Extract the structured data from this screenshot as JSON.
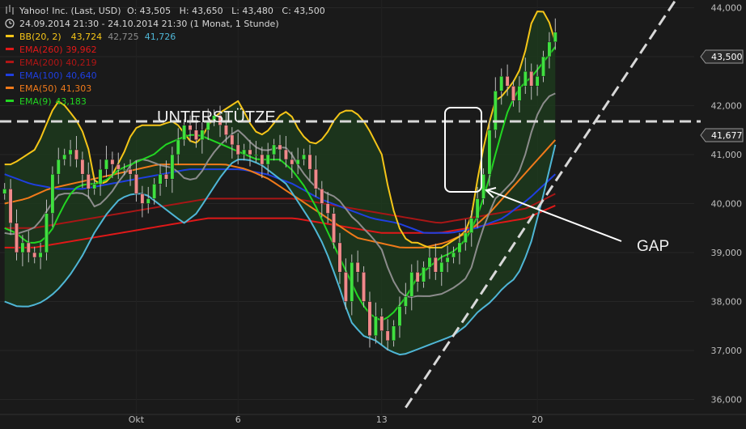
{
  "header": {
    "instrument": "Yahoo! Inc. (Last, USD)",
    "ohlc": "O: 43,505   H: 43,650   L: 43,480   C: 43,500",
    "period": "24.09.2014 21:30 - 24.10.2014 21:30 (1 Monat, 1 Stunde)"
  },
  "legend": [
    {
      "name": "BB(20, 2)",
      "values": [
        "43,724",
        "42,725",
        "41,726"
      ],
      "colors": [
        "#f5c518",
        "#8c8c8c",
        "#4fb6d6"
      ]
    },
    {
      "name": "EMA(260)",
      "values": [
        "39,962"
      ],
      "colors": [
        "#e01818"
      ]
    },
    {
      "name": "EMA(200)",
      "values": [
        "40,219"
      ],
      "colors": [
        "#b01515"
      ]
    },
    {
      "name": "EMA(100)",
      "values": [
        "40,640"
      ],
      "colors": [
        "#1f3fe0"
      ]
    },
    {
      "name": "EMA(50)",
      "values": [
        "41,303"
      ],
      "colors": [
        "#f07a1a"
      ]
    },
    {
      "name": "EMA(9)",
      "values": [
        "43,183"
      ],
      "colors": [
        "#22d622"
      ]
    }
  ],
  "annotations": {
    "support_label": "UNTERSTÜTZE",
    "gap_label": "GAP",
    "support_level": 41.677
  },
  "price_tags": {
    "last": "43,500",
    "support": "41,677"
  },
  "chart_data": {
    "type": "candlestick",
    "title": "Yahoo! Inc. (Last, USD)",
    "ylim": [
      35.8,
      44.5
    ],
    "yticks": [
      36,
      37,
      38,
      39,
      40,
      41,
      42,
      43,
      44
    ],
    "ytick_labels": [
      "36,000",
      "37,000",
      "38,000",
      "39,000",
      "40,000",
      "41,000",
      "42,000",
      "43,000",
      "44,000"
    ],
    "xtick_labels": [
      "Okt",
      "6",
      "13",
      "20"
    ],
    "xtick_index": [
      22,
      39,
      63,
      89
    ],
    "support_line": 41.677,
    "close": [
      40.3,
      39.6,
      39.0,
      39.2,
      39.0,
      38.9,
      39.0,
      39.8,
      40.6,
      40.9,
      41.0,
      41.1,
      40.9,
      40.6,
      40.3,
      40.4,
      40.7,
      40.9,
      40.8,
      40.7,
      40.7,
      40.6,
      40.2,
      40.0,
      40.1,
      40.4,
      40.6,
      40.5,
      41.0,
      41.3,
      41.6,
      41.5,
      41.3,
      41.5,
      41.7,
      41.8,
      41.6,
      41.4,
      41.2,
      41.0,
      41.1,
      41.0,
      41.0,
      40.8,
      41.0,
      41.2,
      41.1,
      40.9,
      40.8,
      40.9,
      41.0,
      40.7,
      40.3,
      40.0,
      39.8,
      39.2,
      38.6,
      38.0,
      38.8,
      38.6,
      38.0,
      37.3,
      37.7,
      37.4,
      37.2,
      37.5,
      37.9,
      38.1,
      38.6,
      38.4,
      38.7,
      38.9,
      38.6,
      38.8,
      38.9,
      39.0,
      39.2,
      39.4,
      39.7,
      40.1,
      40.6,
      41.5,
      42.3,
      42.6,
      42.4,
      42.1,
      42.4,
      42.7,
      42.4,
      42.6,
      43.0,
      43.3,
      43.5
    ],
    "bb_upper": [
      40.8,
      40.8,
      40.9,
      41.0,
      41.1,
      41.4,
      41.8,
      42.1,
      42.0,
      41.8,
      41.6,
      41.2,
      40.4,
      40.4,
      40.5,
      40.8,
      41.1,
      41.5,
      41.6,
      41.6,
      41.6,
      41.6,
      41.7,
      41.6,
      41.4,
      41.2,
      41.3,
      41.6,
      41.8,
      41.9,
      42.0,
      42.1,
      41.8,
      41.5,
      41.4,
      41.5,
      41.7,
      41.9,
      41.8,
      41.5,
      41.3,
      41.2,
      41.3,
      41.5,
      41.8,
      41.9,
      41.9,
      41.8,
      41.6,
      41.3,
      41.0,
      40.2,
      39.6,
      39.3,
      39.2,
      39.2,
      39.1,
      39.1,
      39.1,
      39.2,
      39.3,
      39.4,
      39.8,
      40.8,
      41.5,
      42.1,
      42.2,
      42.4,
      42.6,
      43.1,
      43.8,
      44.0,
      43.8,
      43.3
    ],
    "bb_lower": [
      38.0,
      37.9,
      37.9,
      38.0,
      38.2,
      38.5,
      38.9,
      39.4,
      39.8,
      40.1,
      40.2,
      40.2,
      40.0,
      39.8,
      39.6,
      39.8,
      40.2,
      40.6,
      40.9,
      40.9,
      40.8,
      40.6,
      40.4,
      40.0,
      39.6,
      39.1,
      38.4,
      37.6,
      37.3,
      37.2,
      37.0,
      36.9,
      37.0,
      37.1,
      37.2,
      37.3,
      37.5,
      37.8,
      38.0,
      38.3,
      38.5,
      39.1,
      40.1,
      41.2
    ],
    "ema9": [
      39.5,
      39.4,
      39.2,
      39.2,
      39.4,
      39.9,
      40.3,
      40.4,
      40.4,
      40.5,
      40.7,
      40.8,
      40.9,
      41.0,
      41.2,
      41.3,
      41.4,
      41.4,
      41.3,
      41.2,
      41.1,
      41.0,
      40.9,
      40.9,
      40.9,
      40.7,
      40.4,
      40.0,
      39.5,
      39.0,
      38.5,
      38.0,
      37.7,
      37.6,
      37.8,
      38.1,
      38.5,
      38.7,
      38.9,
      39.0,
      39.2,
      39.6,
      40.3,
      41.2,
      42.0,
      42.4,
      42.6,
      42.9,
      43.2
    ],
    "ema50": [
      40.0,
      40.1,
      40.3,
      40.4,
      40.5,
      40.6,
      40.7,
      40.8,
      40.8,
      40.8,
      40.8,
      40.7,
      40.5,
      40.2,
      39.9,
      39.6,
      39.3,
      39.2,
      39.1,
      39.1,
      39.2,
      39.4,
      39.8,
      40.3,
      40.8,
      41.3
    ],
    "ema100": [
      40.6,
      40.4,
      40.3,
      40.3,
      40.4,
      40.5,
      40.6,
      40.7,
      40.7,
      40.7,
      40.6,
      40.4,
      40.1,
      39.9,
      39.7,
      39.6,
      39.4,
      39.4,
      39.5,
      39.7,
      40.1,
      40.6
    ],
    "ema200": [
      39.5,
      39.5,
      39.6,
      39.7,
      39.8,
      39.9,
      40.0,
      40.1,
      40.1,
      40.1,
      40.1,
      40.0,
      39.9,
      39.8,
      39.7,
      39.6,
      39.7,
      39.8,
      39.9,
      40.2
    ],
    "ema260": [
      39.1,
      39.1,
      39.2,
      39.3,
      39.4,
      39.5,
      39.6,
      39.7,
      39.7,
      39.7,
      39.7,
      39.6,
      39.5,
      39.4,
      39.4,
      39.4,
      39.5,
      39.6,
      39.7,
      39.96
    ],
    "trendline": {
      "from": [
        67,
        35.8
      ],
      "to": [
        102,
        44.5
      ]
    }
  }
}
